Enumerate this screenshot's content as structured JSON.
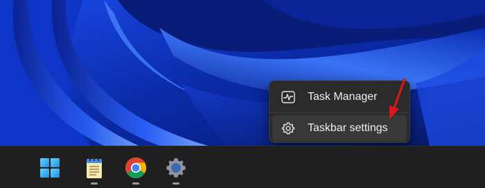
{
  "desktop": {
    "wallpaper": "windows-11-bloom-blue",
    "colors": {
      "dark": "#06145c",
      "mid": "#1a3fd6",
      "light": "#5b93ff"
    }
  },
  "context_menu": {
    "items": [
      {
        "label": "Task Manager",
        "icon": "task-manager-icon"
      },
      {
        "label": "Taskbar settings",
        "icon": "gear-icon"
      }
    ]
  },
  "annotation": {
    "arrow_color": "#e0141b"
  },
  "taskbar": {
    "background": "#1f1f1f",
    "apps": [
      {
        "name": "start",
        "icon": "windows-logo-icon"
      },
      {
        "name": "notepad",
        "icon": "notepad-icon"
      },
      {
        "name": "chrome",
        "icon": "chrome-icon"
      },
      {
        "name": "settings",
        "icon": "settings-gear-icon"
      }
    ]
  }
}
